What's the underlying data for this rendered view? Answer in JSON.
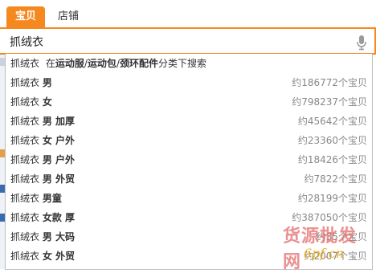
{
  "tabs": [
    {
      "label": "宝贝",
      "active": true
    },
    {
      "label": "店铺",
      "active": false
    }
  ],
  "search": {
    "value": "抓绒衣"
  },
  "suggestion_hint": {
    "keyword": "抓绒衣",
    "prefix": "在",
    "cat1": "运动服",
    "sep1": "/",
    "cat2": "运动包",
    "sep2": "/",
    "cat3": "颈环配件",
    "suffix": "分类下搜索"
  },
  "suggestions": [
    {
      "base": "抓绒衣",
      "extra": "男",
      "count": "约186772个宝贝"
    },
    {
      "base": "抓绒衣",
      "extra": "女",
      "count": "约798237个宝贝"
    },
    {
      "base": "抓绒衣",
      "extra": "男 加厚",
      "count": "约45642个宝贝"
    },
    {
      "base": "抓绒衣",
      "extra": "女 户外",
      "count": "约23360个宝贝"
    },
    {
      "base": "抓绒衣",
      "extra": "男 户外",
      "count": "约18426个宝贝"
    },
    {
      "base": "抓绒衣",
      "extra": "男 外贸",
      "count": "约7822个宝贝"
    },
    {
      "base": "抓绒衣",
      "extra": "男童",
      "count": "约28199个宝贝"
    },
    {
      "base": "抓绒衣",
      "extra": "女款 厚",
      "count": "约387050个宝贝"
    },
    {
      "base": "抓绒衣",
      "extra": "男 大码",
      "count": "约35个宝贝"
    },
    {
      "base": "抓绒衣",
      "extra": "女 外贸",
      "count": "约2007个宝贝"
    }
  ],
  "watermark": {
    "title": "货源批发网",
    "url": "6pf.cn"
  },
  "colors": {
    "accent": "#f5891f",
    "count_text": "#888888"
  },
  "icons": {
    "mic": "microphone-icon"
  }
}
